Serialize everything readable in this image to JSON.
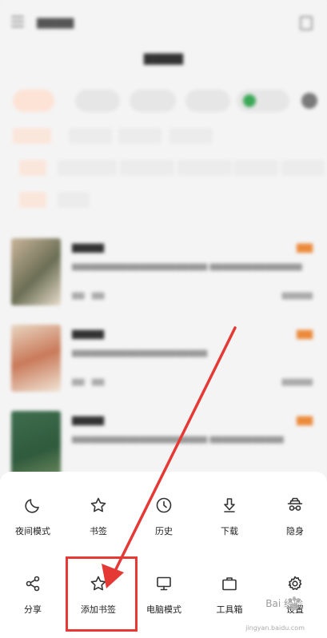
{
  "menu": {
    "row1": [
      {
        "icon": "moon-icon",
        "label": "夜间模式",
        "name": "night-mode-button"
      },
      {
        "icon": "star-icon",
        "label": "书签",
        "name": "bookmarks-button"
      },
      {
        "icon": "clock-icon",
        "label": "历史",
        "name": "history-button"
      },
      {
        "icon": "download-icon",
        "label": "下载",
        "name": "download-button"
      },
      {
        "icon": "incognito-icon",
        "label": "隐身",
        "name": "incognito-button"
      }
    ],
    "row2": [
      {
        "icon": "share-icon",
        "label": "分享",
        "name": "share-button"
      },
      {
        "icon": "star-add-icon",
        "label": "添加书签",
        "name": "add-bookmark-button"
      },
      {
        "icon": "monitor-icon",
        "label": "电脑模式",
        "name": "desktop-mode-button"
      },
      {
        "icon": "toolbox-icon",
        "label": "工具箱",
        "name": "toolbox-button"
      },
      {
        "icon": "gear-icon",
        "label": "设置",
        "name": "settings-button"
      }
    ]
  },
  "watermark": {
    "text": "Bai 经验",
    "url": "jingyan.baidu.com"
  },
  "colors": {
    "accent": "#ec6a3b",
    "annotation": "#e53935",
    "sheet": "#ffffff"
  }
}
